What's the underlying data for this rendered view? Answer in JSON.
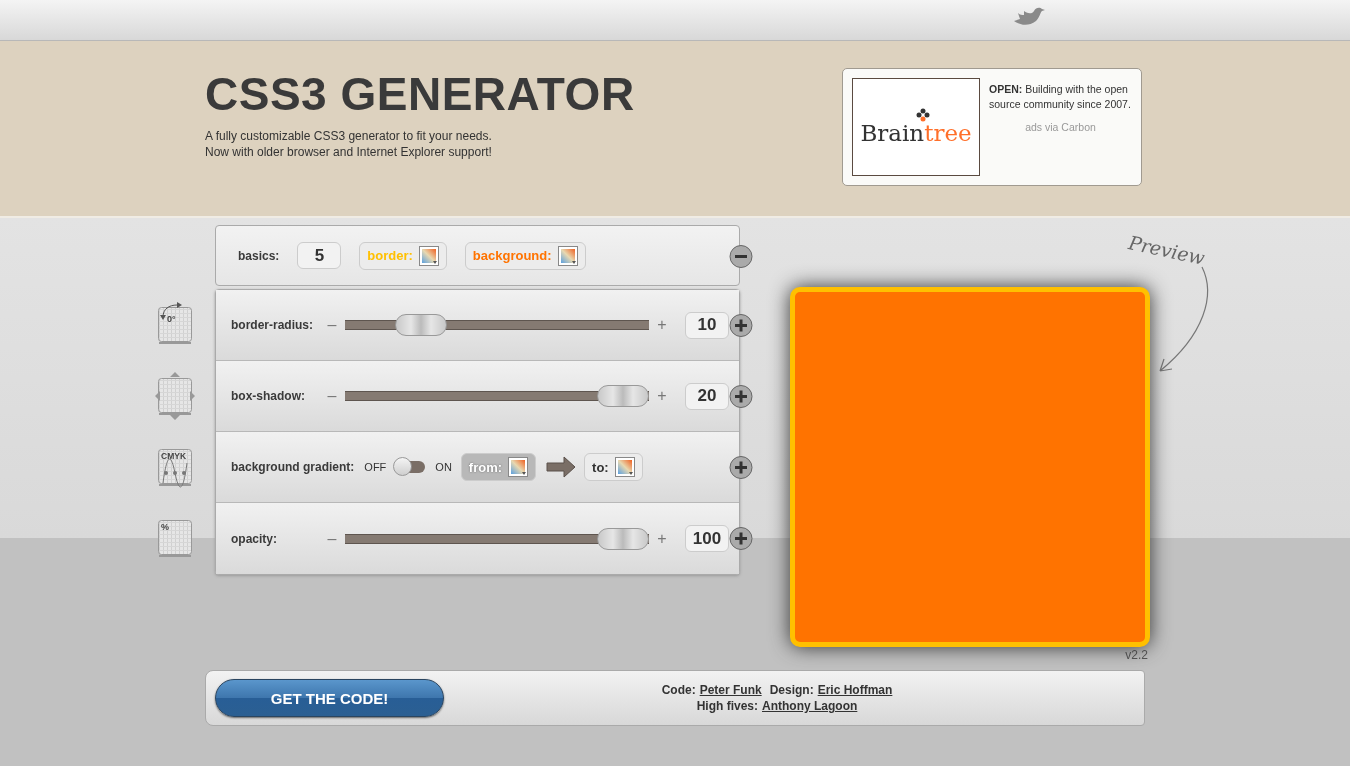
{
  "header": {
    "title": "CSS3 GENERATOR",
    "tagline": [
      "A fully customizable CSS3 generator to fit your needs.",
      "Now with older browser and Internet Explorer support!"
    ]
  },
  "ad": {
    "logo_parts": [
      "Brain",
      "tree"
    ],
    "text": "**OPEN:** Building with the open source community since 2007.",
    "credit": "ads via Carbon"
  },
  "basics": {
    "label": "basics:",
    "value": "5",
    "border": {
      "label": "border:",
      "color": "#ffc000"
    },
    "background": {
      "label": "background:",
      "color": "#ff7300"
    },
    "expanded": true
  },
  "rows": [
    {
      "kind": "slider",
      "icon_label": "0°",
      "label": "border-radius:",
      "minus": "–",
      "plus": "+",
      "level": 0.2,
      "value": "10"
    },
    {
      "kind": "slider",
      "label": "box-shadow:",
      "minus": "–",
      "plus": "+",
      "level": 1,
      "value": "20"
    },
    {
      "kind": "toggle",
      "icon_label": "CMYK",
      "label": "background gradient:",
      "off": "OFF",
      "on_label": "ON",
      "on": false,
      "from": "from:",
      "to": "to:"
    },
    {
      "kind": "slider",
      "icon_label": "%",
      "label": "opacity:",
      "minus": "–",
      "plus": "+",
      "level": 1,
      "value": "100"
    }
  ],
  "preview": {
    "label": "Preview",
    "version": "v2.2"
  },
  "footer": {
    "button": "GET THE CODE!",
    "credits": [
      [
        {
          "text": "Code:"
        },
        {
          "link": "Peter Funk"
        },
        {
          "text": "Design:"
        },
        {
          "link": "Eric Hoffman"
        }
      ],
      [
        {
          "text": "High fives:"
        },
        {
          "link": "Anthony Lagoon"
        }
      ]
    ]
  }
}
